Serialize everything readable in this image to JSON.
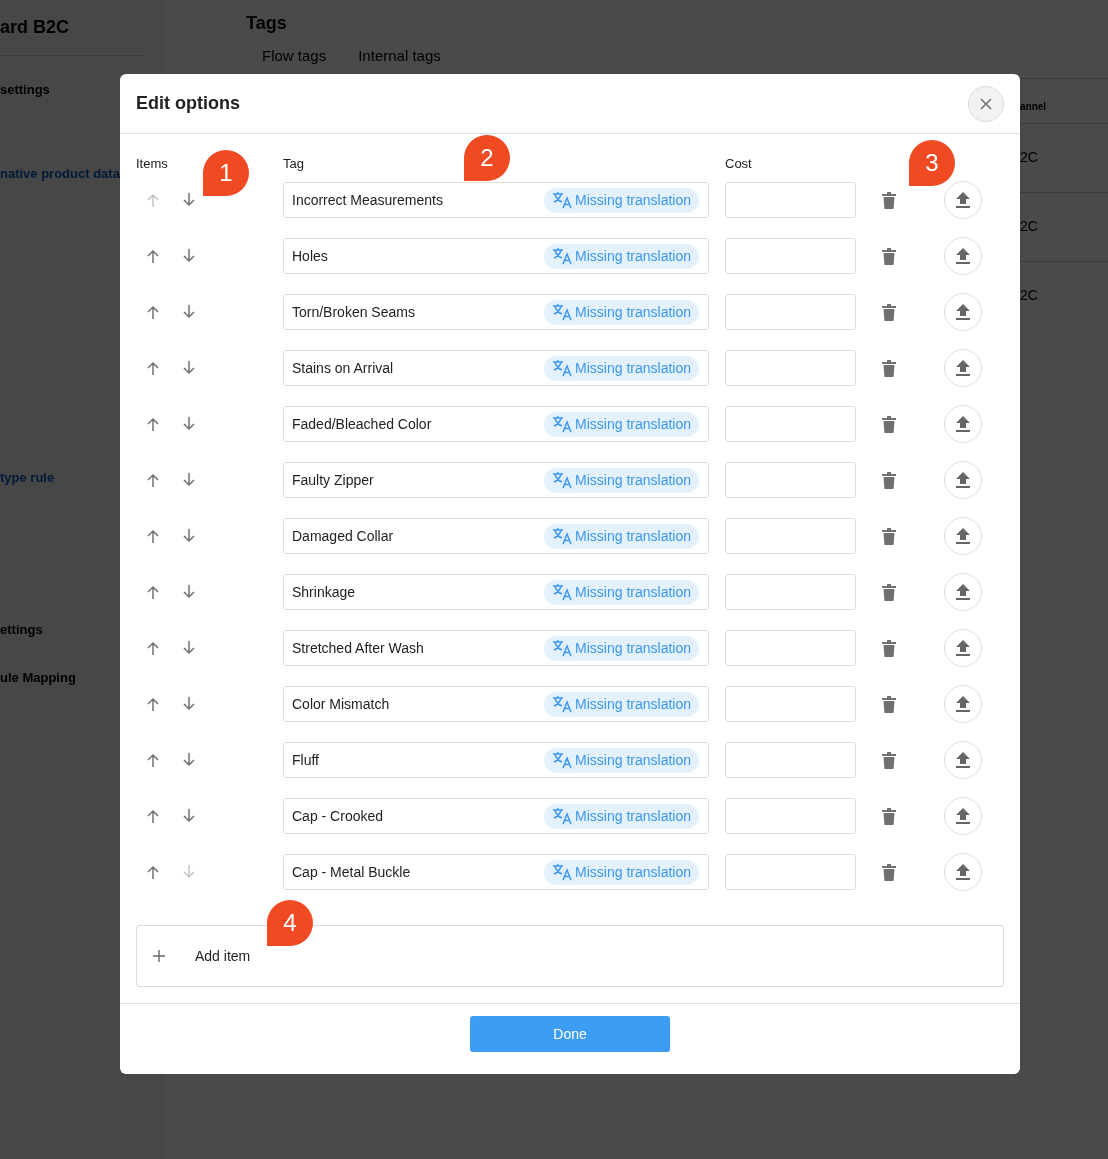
{
  "background": {
    "sidebar_title": "ard B2C",
    "sidebar_items": [
      {
        "label": "settings",
        "kind": "text"
      },
      {
        "label": "native product data",
        "kind": "link"
      },
      {
        "label": "type rule",
        "kind": "link"
      },
      {
        "label": "ettings",
        "kind": "text"
      },
      {
        "label": "ule Mapping",
        "kind": "text"
      }
    ],
    "page_title": "Tags",
    "tabs": [
      {
        "label": "Flow tags"
      },
      {
        "label": "Internal tags"
      }
    ],
    "table_header": "annel",
    "table_cells": [
      "2C",
      "2C",
      "2C"
    ]
  },
  "dialog": {
    "title": "Edit options",
    "columns": [
      "Items",
      "Tag",
      "Cost"
    ],
    "items": [
      {
        "tag": "Incorrect Measurements",
        "badge": "Missing translation",
        "up_disabled": true,
        "down_disabled": false
      },
      {
        "tag": "Holes",
        "badge": "Missing translation",
        "up_disabled": false,
        "down_disabled": false
      },
      {
        "tag": "Torn/Broken Seams",
        "badge": "Missing translation",
        "up_disabled": false,
        "down_disabled": false
      },
      {
        "tag": "Stains on Arrival",
        "badge": "Missing translation",
        "up_disabled": false,
        "down_disabled": false
      },
      {
        "tag": "Faded/Bleached Color",
        "badge": "Missing translation",
        "up_disabled": false,
        "down_disabled": false
      },
      {
        "tag": "Faulty Zipper",
        "badge": "Missing translation",
        "up_disabled": false,
        "down_disabled": false
      },
      {
        "tag": "Damaged Collar",
        "badge": "Missing translation",
        "up_disabled": false,
        "down_disabled": false
      },
      {
        "tag": "Shrinkage",
        "badge": "Missing translation",
        "up_disabled": false,
        "down_disabled": false
      },
      {
        "tag": "Stretched After Wash",
        "badge": "Missing translation",
        "up_disabled": false,
        "down_disabled": false
      },
      {
        "tag": "Color Mismatch",
        "badge": "Missing translation",
        "up_disabled": false,
        "down_disabled": false
      },
      {
        "tag": "Fluff",
        "badge": "Missing translation",
        "up_disabled": false,
        "down_disabled": false
      },
      {
        "tag": "Cap - Crooked",
        "badge": "Missing translation",
        "up_disabled": false,
        "down_disabled": false
      },
      {
        "tag": "Cap - Metal Buckle",
        "badge": "Missing translation",
        "up_disabled": false,
        "down_disabled": true
      }
    ],
    "add_item": "Add item",
    "done": "Done"
  },
  "callouts": [
    "1",
    "2",
    "3",
    "4"
  ]
}
